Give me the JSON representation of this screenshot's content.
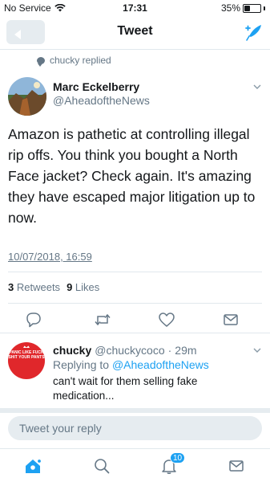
{
  "status_bar": {
    "carrier": "No Service",
    "time": "17:31",
    "battery": "35%",
    "battery_level": 0.35
  },
  "nav": {
    "title": "Tweet"
  },
  "context": {
    "text": "chucky replied"
  },
  "tweet": {
    "author_name": "Marc Eckelberry",
    "author_handle": "@AheadoftheNews",
    "text": "Amazon is pathetic at controlling illegal rip offs. You think you bought a North Face jacket? Check again. It's amazing they have escaped major litigation up to now.",
    "date": "10/07/2018, 16:59",
    "retweets_count": "3",
    "retweets_label": "Retweets",
    "likes_count": "9",
    "likes_label": "Likes"
  },
  "reply": {
    "avatar_text": "PANIC LIKE FUCK SHIT YOUR PANTS",
    "name": "chucky",
    "handle": "@chuckycoco",
    "separator": "·",
    "time": "29m",
    "replying_prefix": "Replying to",
    "replying_to": "@AheadoftheNews",
    "text": "can't wait for them selling fake medication..."
  },
  "composer": {
    "placeholder": "Tweet your reply"
  },
  "tab_bar": {
    "notification_count": "10"
  },
  "colors": {
    "accent": "#1da1f2",
    "secondary_text": "#657786",
    "divider": "#e1e8ed",
    "avatar_red": "#e0272b"
  },
  "icons": [
    "wifi-icon",
    "back-icon",
    "compose-icon",
    "reply-bubble-icon",
    "caret-down-icon",
    "reply-icon",
    "retweet-icon",
    "like-icon",
    "message-icon",
    "home-icon",
    "search-icon",
    "notifications-icon",
    "messages-icon"
  ]
}
